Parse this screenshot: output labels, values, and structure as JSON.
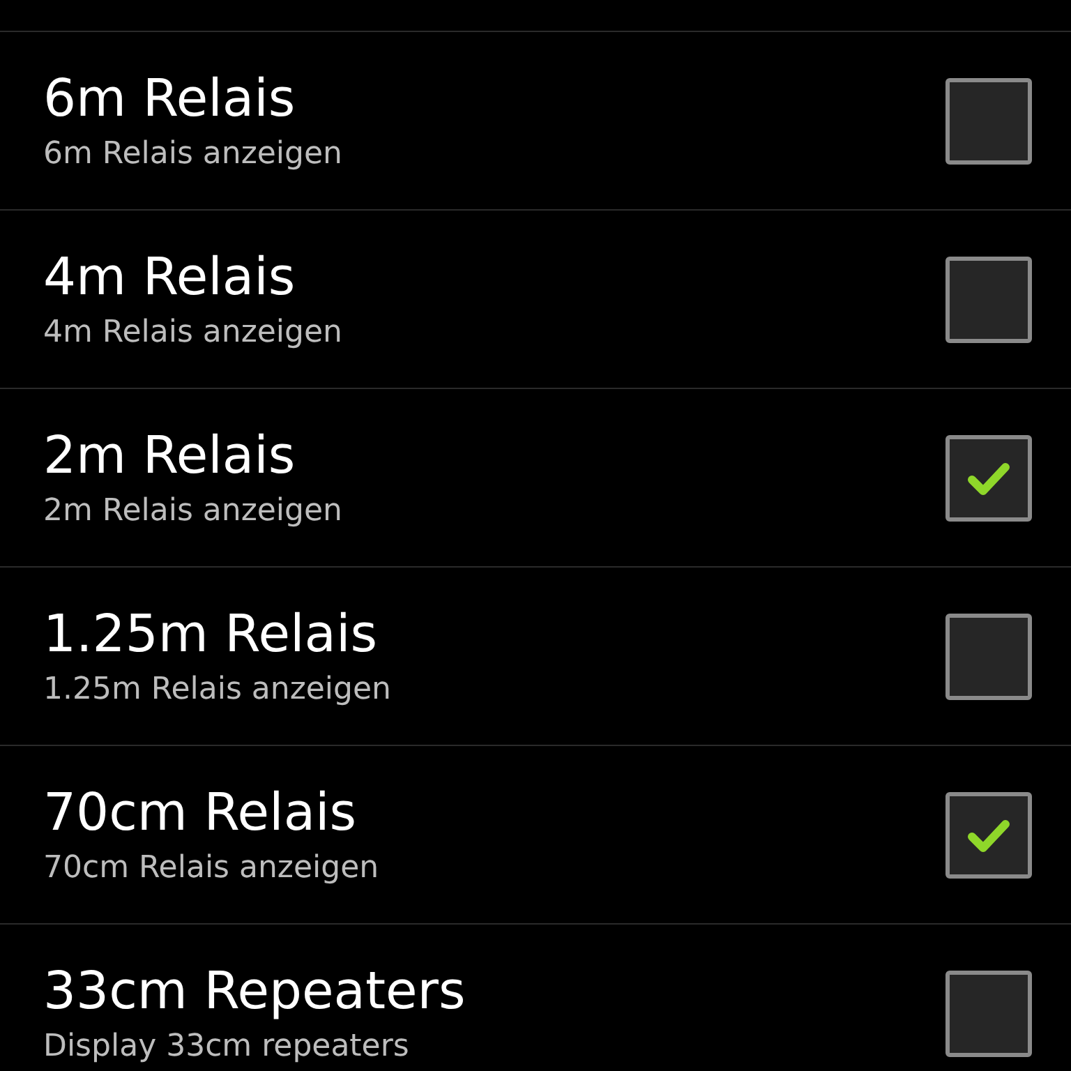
{
  "preferences": [
    {
      "title": "6m Relais",
      "summary": "6m Relais anzeigen",
      "checked": false
    },
    {
      "title": "4m Relais",
      "summary": "4m Relais anzeigen",
      "checked": false
    },
    {
      "title": "2m Relais",
      "summary": "2m Relais anzeigen",
      "checked": true
    },
    {
      "title": "1.25m Relais",
      "summary": "1.25m Relais anzeigen",
      "checked": false
    },
    {
      "title": "70cm Relais",
      "summary": "70cm Relais anzeigen",
      "checked": true
    },
    {
      "title": "33cm Repeaters",
      "summary": "Display 33cm repeaters",
      "checked": false
    }
  ]
}
